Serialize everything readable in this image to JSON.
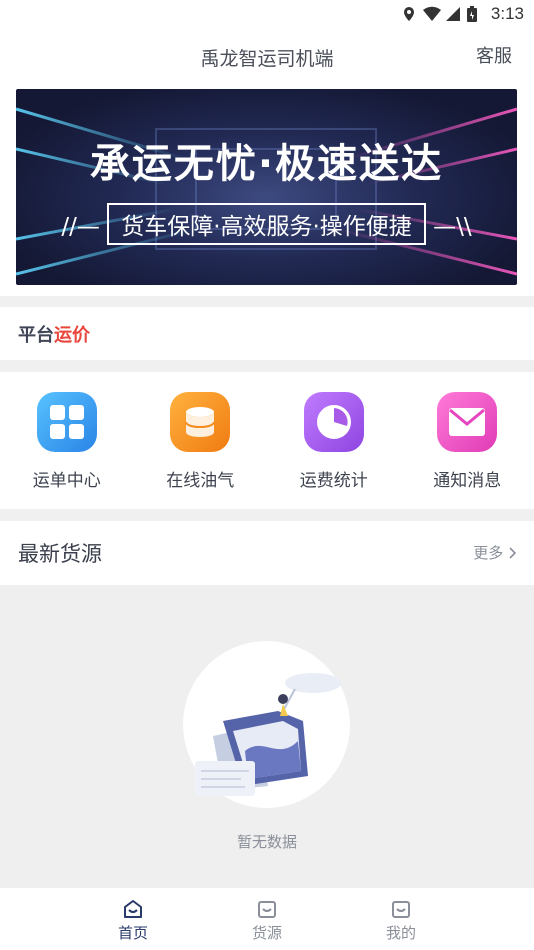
{
  "status_bar": {
    "time": "3:13",
    "icons": [
      "location-icon",
      "wifi-icon",
      "signal-icon",
      "battery-icon"
    ]
  },
  "nav": {
    "title": "禹龙智运司机端",
    "right_label": "客服"
  },
  "banner": {
    "headline": "承运无忧·极速送达",
    "sub": "货车保障·高效服务·操作便捷",
    "sub_left_deco": "//—",
    "sub_right_deco": "—\\\\"
  },
  "platform_price": {
    "label_a": "平台",
    "label_b": "运价",
    "color_b": "#e8453c"
  },
  "grid": [
    {
      "label": "运单中心",
      "icon": "grid-four-icon",
      "color": "#3aa0f0"
    },
    {
      "label": "在线油气",
      "icon": "oil-barrel-icon",
      "color": "#f29322"
    },
    {
      "label": "运费统计",
      "icon": "pie-chart-icon",
      "color": "#a75be8"
    },
    {
      "label": "通知消息",
      "icon": "envelope-icon",
      "color": "#ee4fc5"
    }
  ],
  "latest": {
    "title": "最新货源",
    "more": "更多"
  },
  "empty": {
    "text": "暂无数据",
    "icon": "folder-empty-illustration"
  },
  "tabbar": [
    {
      "label": "首页",
      "icon": "home-icon",
      "active": true
    },
    {
      "label": "货源",
      "icon": "cargo-icon",
      "active": false
    },
    {
      "label": "我的",
      "icon": "profile-icon",
      "active": false
    }
  ]
}
